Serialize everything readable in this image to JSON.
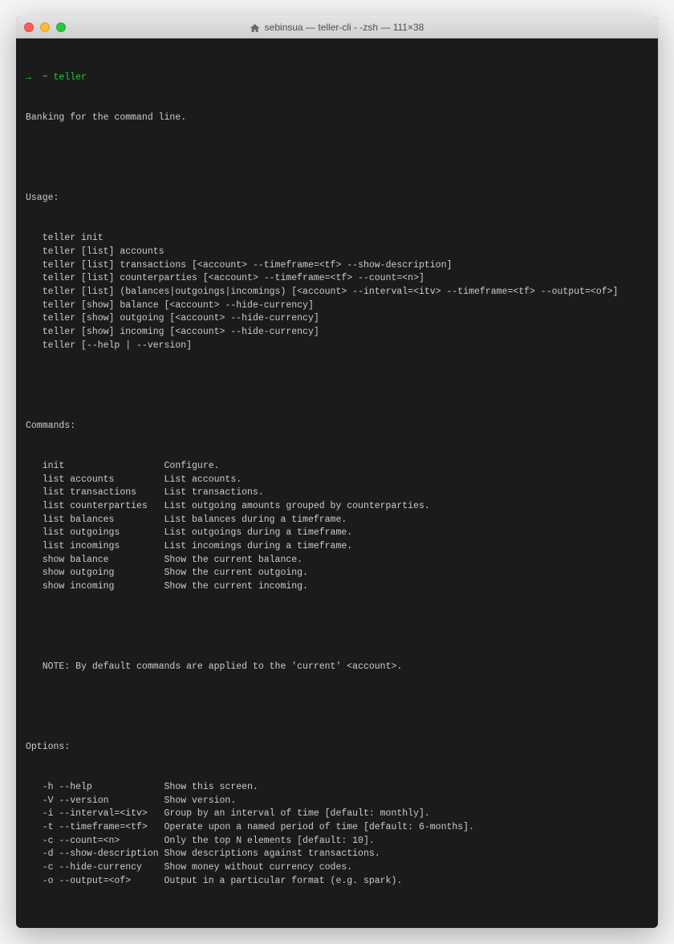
{
  "window": {
    "title": "sebinsua — teller-cli - -zsh — 111×38"
  },
  "prompt": {
    "arrow": "→",
    "tilde": "~",
    "command": "teller"
  },
  "header": "Banking for the command line.",
  "usage_title": "Usage:",
  "usage_lines": [
    "teller init",
    "teller [list] accounts",
    "teller [list] transactions [<account> --timeframe=<tf> --show-description]",
    "teller [list] counterparties [<account> --timeframe=<tf> --count=<n>]",
    "teller [list] (balances|outgoings|incomings) [<account> --interval=<itv> --timeframe=<tf> --output=<of>]",
    "teller [show] balance [<account> --hide-currency]",
    "teller [show] outgoing [<account> --hide-currency]",
    "teller [show] incoming [<account> --hide-currency]",
    "teller [--help | --version]"
  ],
  "commands_title": "Commands:",
  "commands": [
    {
      "name": "init",
      "desc": "Configure."
    },
    {
      "name": "list accounts",
      "desc": "List accounts."
    },
    {
      "name": "list transactions",
      "desc": "List transactions."
    },
    {
      "name": "list counterparties",
      "desc": "List outgoing amounts grouped by counterparties."
    },
    {
      "name": "list balances",
      "desc": "List balances during a timeframe."
    },
    {
      "name": "list outgoings",
      "desc": "List outgoings during a timeframe."
    },
    {
      "name": "list incomings",
      "desc": "List incomings during a timeframe."
    },
    {
      "name": "show balance",
      "desc": "Show the current balance."
    },
    {
      "name": "show outgoing",
      "desc": "Show the current outgoing."
    },
    {
      "name": "show incoming",
      "desc": "Show the current incoming."
    }
  ],
  "commands_note": "NOTE: By default commands are applied to the 'current' <account>.",
  "options_title": "Options:",
  "options": [
    {
      "flag": "-h --help",
      "desc": "Show this screen."
    },
    {
      "flag": "-V --version",
      "desc": "Show version."
    },
    {
      "flag": "-i --interval=<itv>",
      "desc": "Group by an interval of time [default: monthly]."
    },
    {
      "flag": "-t --timeframe=<tf>",
      "desc": "Operate upon a named period of time [default: 6-months]."
    },
    {
      "flag": "-c --count=<n>",
      "desc": "Only the top N elements [default: 10]."
    },
    {
      "flag": "-d --show-description",
      "desc": "Show descriptions against transactions."
    },
    {
      "flag": "-c --hide-currency",
      "desc": "Show money without currency codes."
    },
    {
      "flag": "-o --output=<of>",
      "desc": "Output in a particular format (e.g. spark)."
    }
  ]
}
